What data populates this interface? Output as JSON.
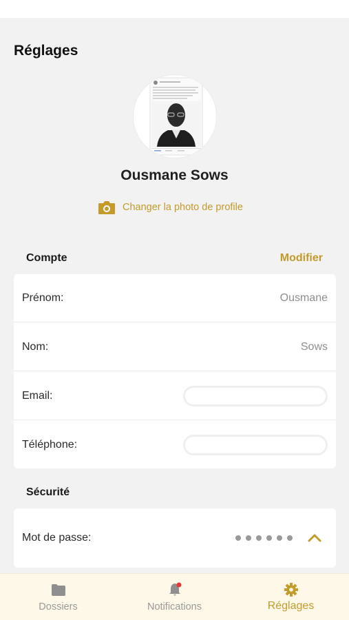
{
  "header": {
    "title": "Réglages"
  },
  "profile": {
    "name": "Ousmane Sows",
    "change_photo_label": "Changer la photo de profile"
  },
  "account": {
    "section_title": "Compte",
    "modify_label": "Modifier",
    "fields": [
      {
        "label": "Prénom:",
        "value": "Ousmane"
      },
      {
        "label": "Nom:",
        "value": "Sows"
      },
      {
        "label": "Email:",
        "value": ""
      },
      {
        "label": "Téléphone:",
        "value": ""
      }
    ]
  },
  "security": {
    "section_title": "Sécurité",
    "password_label": "Mot de passe:",
    "password_masked_length": 6
  },
  "tabbar": {
    "tabs": [
      {
        "label": "Dossiers",
        "icon": "folder-icon",
        "active": false
      },
      {
        "label": "Notifications",
        "icon": "bell-icon",
        "active": false,
        "has_badge": true
      },
      {
        "label": "Réglages",
        "icon": "gear-icon",
        "active": true
      }
    ]
  },
  "colors": {
    "accent": "#c49a2a",
    "background": "#f2f2f2",
    "tabbar_background": "#fdf8e8",
    "badge": "#e53935"
  }
}
